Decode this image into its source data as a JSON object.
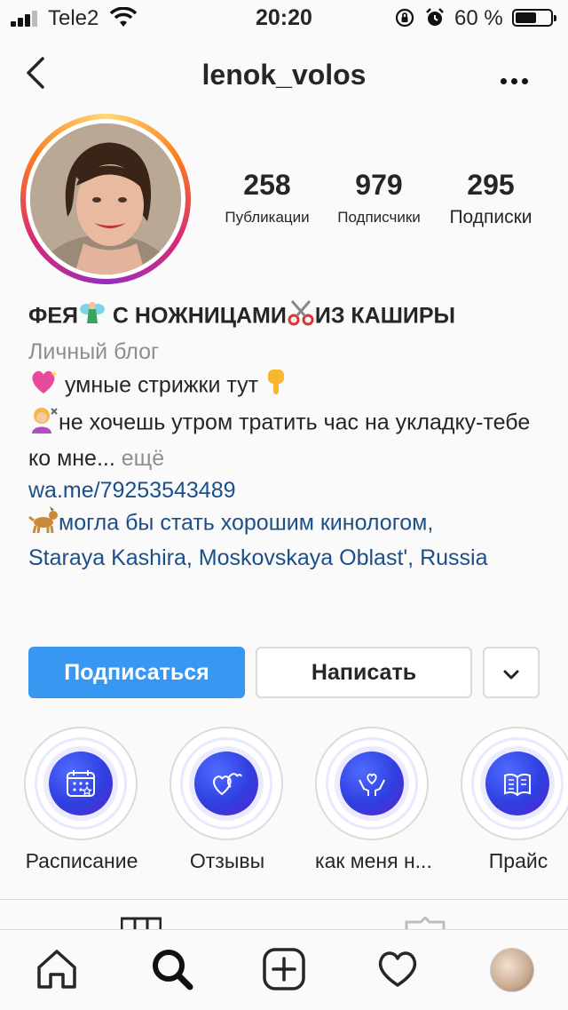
{
  "status_bar": {
    "carrier": "Tele2",
    "time": "20:20",
    "battery_percent": "60 %",
    "battery_level": 0.6
  },
  "header": {
    "username": "lenok_volos",
    "back_icon": "chevron-left-icon",
    "more_icon": "more-horizontal-icon"
  },
  "stats": [
    {
      "value": "258",
      "label": "Публикации"
    },
    {
      "value": "979",
      "label": "Подписчики"
    },
    {
      "value": "295",
      "label": "Подписки"
    }
  ],
  "bio": {
    "name_part1": "ФЕЯ",
    "name_part2": " С НОЖНИЦАМИ",
    "name_part3": "ИЗ КАШИРЫ",
    "category": "Личный блог",
    "line1": " умные стрижки тут ",
    "line2": "не хочешь утром тратить час на укладку-тебе",
    "line3": "ко мне...",
    "more_label": " ещё",
    "website": "wa.me/79253543489",
    "location_prefix": "могла бы стать хорошим кинологом,",
    "location": "Staraya Kashira, Moskovskaya Oblast', Russia"
  },
  "buttons": {
    "follow": "Подписаться",
    "message": "Написать",
    "dropdown_icon": "chevron-down-icon"
  },
  "highlights": [
    {
      "label": "Расписание",
      "icon": "calendar-icon"
    },
    {
      "label": "Отзывы",
      "icon": "hearts-icon"
    },
    {
      "label": "как меня н...",
      "icon": "heart-hands-icon"
    },
    {
      "label": "Прайс",
      "icon": "book-icon"
    }
  ],
  "nav": [
    "home-icon",
    "search-icon",
    "add-post-icon",
    "heart-icon",
    "profile-avatar"
  ],
  "colors": {
    "follow_button": "#3897f0",
    "link": "#1b4f8a",
    "secondary_text": "#8e8e8e",
    "highlight_core": "#2f3fe0"
  }
}
